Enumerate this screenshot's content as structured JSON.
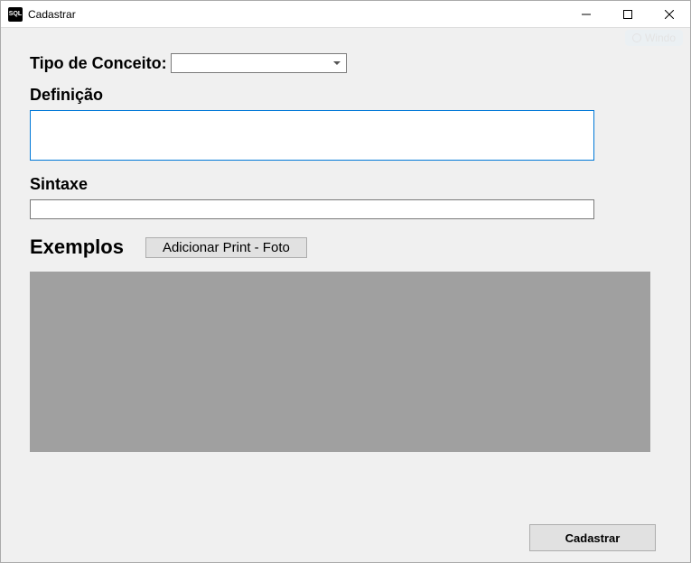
{
  "window": {
    "title": "Cadastrar",
    "icon_text": "SQL"
  },
  "form": {
    "tipo_label": "Tipo de Conceito:",
    "tipo_value": "",
    "definicao_label": "Definição",
    "definicao_value": "",
    "sintaxe_label": "Sintaxe",
    "sintaxe_value": "",
    "exemplos_label": "Exemplos",
    "add_print_label": "Adicionar Print - Foto",
    "cadastrar_label": "Cadastrar"
  },
  "ghost": {
    "text": "Windo"
  }
}
